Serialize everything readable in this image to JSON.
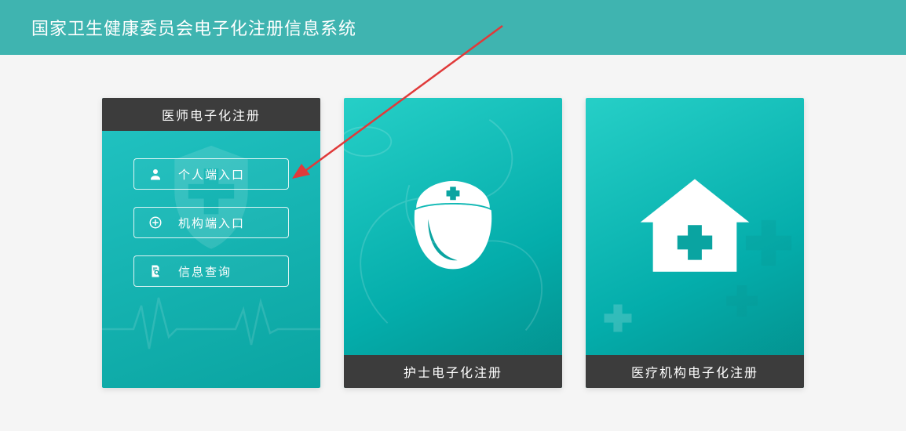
{
  "header": {
    "title": "国家卫生健康委员会电子化注册信息系统"
  },
  "cards": {
    "doctor": {
      "title": "医师电子化注册",
      "buttons": {
        "personal": {
          "label": "个人端入口",
          "icon": "user-icon"
        },
        "org": {
          "label": "机构端入口",
          "icon": "medical-cross-icon"
        },
        "query": {
          "label": "信息查询",
          "icon": "document-search-icon"
        }
      }
    },
    "nurse": {
      "title": "护士电子化注册",
      "icon": "nurse-cap-icon"
    },
    "institution": {
      "title": "医疗机构电子化注册",
      "icon": "hospital-house-icon"
    }
  },
  "colors": {
    "brand": "#3fb4b0",
    "cardGradientFrom": "#26cfc7",
    "cardGradientTo": "#038d8a",
    "dark": "#3c3c3c",
    "annotation": "#e03a3a"
  }
}
